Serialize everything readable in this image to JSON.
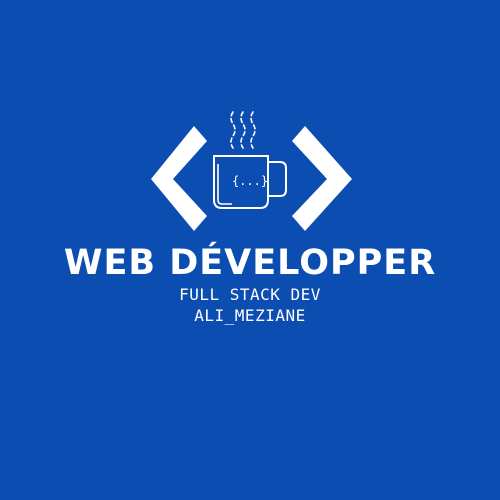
{
  "colors": {
    "background": "#0c4db1",
    "foreground": "#ffffff"
  },
  "logo": {
    "icons": [
      "left-chevron-icon",
      "right-chevron-icon",
      "coffee-mug-icon",
      "steam-icon"
    ],
    "mug_text": "{...}"
  },
  "title": "WEB DÉVELOPPER",
  "subtitle": "FULL STACK DEV",
  "name": "ALI_MEZIANE"
}
